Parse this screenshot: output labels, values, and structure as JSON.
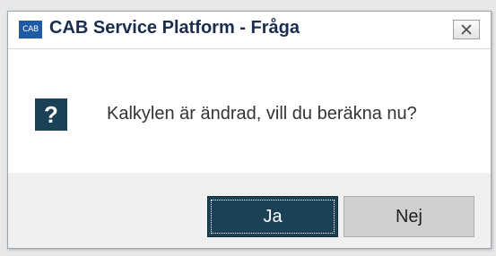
{
  "window": {
    "app_icon_text": "CAB",
    "title": "CAB Service Platform - Fråga"
  },
  "icons": {
    "app": "cab-app-icon",
    "close": "close-icon",
    "question": "question-icon"
  },
  "dialog": {
    "question_symbol": "?",
    "message": "Kalkylen är ändrad, vill du beräkna nu?"
  },
  "buttons": {
    "yes_label": "Ja",
    "no_label": "Nej"
  },
  "colors": {
    "accent": "#1b4157",
    "title_text": "#1a2d4f",
    "app_icon_bg": "#1f5aa7"
  }
}
